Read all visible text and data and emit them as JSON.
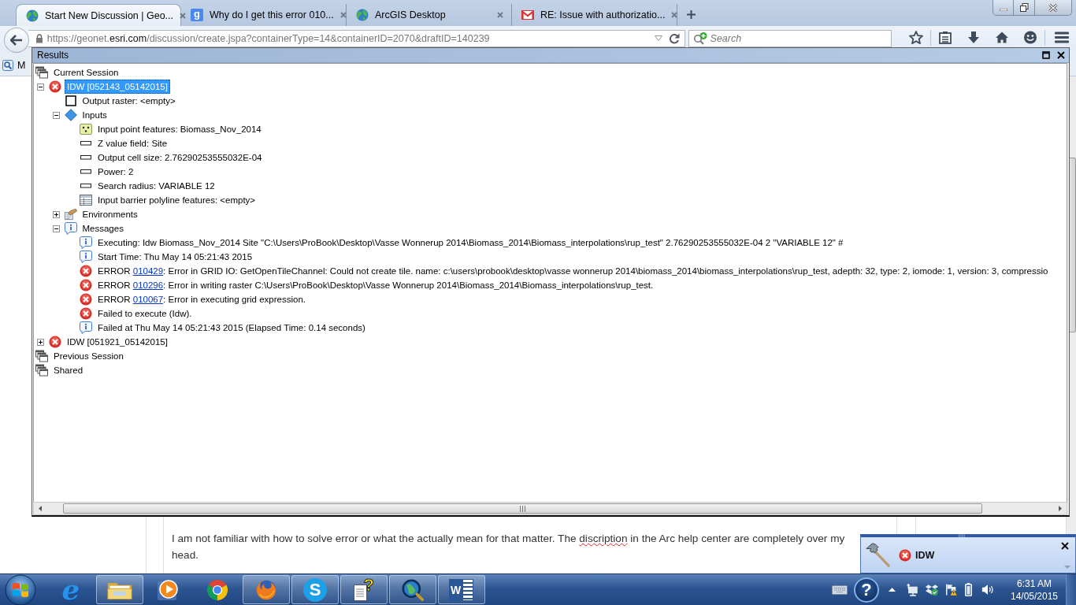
{
  "browser": {
    "tabs": [
      {
        "title": "Start New Discussion | Geo...",
        "selected": true,
        "favicon": {
          "kind": "globe"
        }
      },
      {
        "title": "Why do I get this error 010...",
        "selected": false,
        "favicon": {
          "kind": "letter",
          "text": "g"
        }
      },
      {
        "title": "ArcGIS Desktop",
        "selected": false,
        "favicon": {
          "kind": "globe"
        }
      },
      {
        "title": "RE: Issue with authorizatio...",
        "selected": false,
        "favicon": {
          "kind": "mail"
        }
      }
    ],
    "address": {
      "before": "https://geonet.",
      "domain": "esri.com",
      "after": "/discussion/create.jspa?containerType=14&containerID=2070&draftID=140239"
    },
    "search": {
      "placeholder": "Search"
    },
    "bookmark": {
      "label": "M"
    }
  },
  "page": {
    "paragraph": [
      {
        "text": "I am not familiar with how to solve error or what the actually mean for that matter. The ",
        "misspelled": false
      },
      {
        "text": "discription",
        "misspelled": true
      },
      {
        "text": " in the Arc help center are completely over my head.",
        "misspelled": false
      }
    ]
  },
  "results": {
    "title": "Results",
    "tree": [
      {
        "label": "Current Session",
        "kind": "session",
        "selected": false,
        "children": [
          {
            "label": "IDW [052143_05142015]",
            "kind": "error",
            "selected": true,
            "expanded": true,
            "children": [
              {
                "label": "Output raster: <empty>",
                "kind": "raster",
                "selected": false
              },
              {
                "label": "Inputs",
                "kind": "parameters",
                "selected": false,
                "expanded": true,
                "children": [
                  {
                    "label": "Input point features: Biomass_Nov_2014",
                    "kind": "points",
                    "selected": false
                  },
                  {
                    "label": "Z value field: Site",
                    "kind": "field",
                    "selected": false
                  },
                  {
                    "label": "Output cell size: 2.76290253555032E-04",
                    "kind": "field",
                    "selected": false
                  },
                  {
                    "label": "Power: 2",
                    "kind": "field",
                    "selected": false
                  },
                  {
                    "label": "Search radius: VARIABLE 12",
                    "kind": "field",
                    "selected": false
                  },
                  {
                    "label": "Input barrier polyline features: <empty>",
                    "kind": "table",
                    "selected": false
                  }
                ]
              },
              {
                "label": "Environments",
                "kind": "environments",
                "selected": false,
                "expanded": false
              },
              {
                "label": "Messages",
                "kind": "info",
                "selected": false,
                "expanded": true,
                "children": [
                  {
                    "label": "Executing: Idw Biomass_Nov_2014 Site \"C:\\Users\\ProBook\\Desktop\\Vasse Wonnerup 2014\\Biomass_2014\\Biomass_interpolations\\rup_test\" 2.76290253555032E-04 2 \"VARIABLE 12\" #",
                    "kind": "info",
                    "selected": false
                  },
                  {
                    "label": "Start Time: Thu May 14 05:21:43 2015",
                    "kind": "info",
                    "selected": false
                  },
                  {
                    "code_prefix": "ERROR",
                    "code": "010429",
                    "label": ": Error in GRID IO: GetOpenTileChannel: Could not create tile. name: c:\\users\\probook\\desktop\\vasse wonnerup 2014\\biomass_2014\\biomass_interpolations\\rup_test, adepth: 32, type: 2, iomode: 1, version: 3, compressio",
                    "kind": "error",
                    "selected": false
                  },
                  {
                    "code_prefix": "ERROR",
                    "code": "010296",
                    "label": ": Error in writing raster C:\\Users\\ProBook\\Desktop\\Vasse Wonnerup 2014\\Biomass_2014\\Biomass_interpolations\\rup_test.",
                    "kind": "error",
                    "selected": false
                  },
                  {
                    "code_prefix": "ERROR",
                    "code": "010067",
                    "label": ": Error in executing grid expression.",
                    "kind": "error",
                    "selected": false
                  },
                  {
                    "label": "Failed to execute (Idw).",
                    "kind": "error",
                    "selected": false
                  },
                  {
                    "label": "Failed at Thu May 14 05:21:43 2015 (Elapsed Time: 0.14 seconds)",
                    "kind": "info",
                    "selected": false
                  }
                ]
              }
            ]
          },
          {
            "label": "IDW [051921_05142015]",
            "kind": "error",
            "selected": false,
            "expanded": false
          }
        ]
      },
      {
        "label": "Previous Session",
        "kind": "session",
        "selected": false
      },
      {
        "label": "Shared",
        "kind": "session",
        "selected": false
      }
    ]
  },
  "notification": {
    "title": "IDW"
  },
  "taskbar": {
    "apps": [
      {
        "kind": "ie",
        "running": false,
        "glyph": "e"
      },
      {
        "kind": "folder",
        "running": true
      },
      {
        "kind": "media",
        "running": false
      },
      {
        "kind": "chrome",
        "running": false
      },
      {
        "kind": "firefox",
        "running": true
      },
      {
        "kind": "skype",
        "running": true,
        "glyph": "S"
      },
      {
        "kind": "help",
        "running": true,
        "glyph": "?"
      },
      {
        "kind": "arcgis",
        "running": true
      },
      {
        "kind": "word",
        "running": true,
        "glyph": "W"
      }
    ],
    "tray": {
      "help_glyph": "?",
      "time": "6:31 AM",
      "date": "14/05/2015"
    }
  }
}
